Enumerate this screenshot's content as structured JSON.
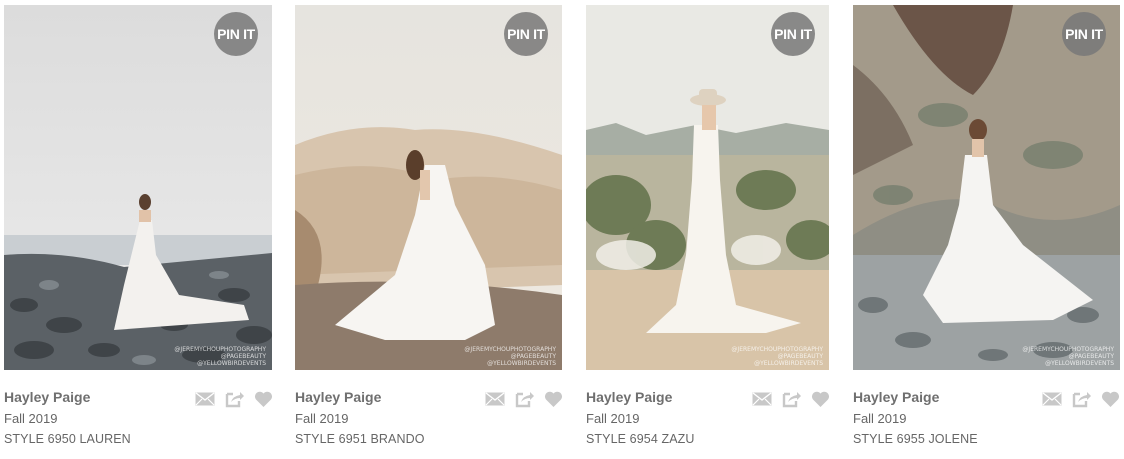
{
  "cards": [
    {
      "pin_label": "PIN IT",
      "designer": "Hayley Paige",
      "season": "Fall 2019",
      "style": "STYLE 6950 LAUREN",
      "credit": [
        "@JEREMYCHOUPHOTOGRAPHY",
        "@PAGEBEAUTY",
        "@YELLOWBIRDEVENTS"
      ]
    },
    {
      "pin_label": "PIN IT",
      "designer": "Hayley Paige",
      "season": "Fall 2019",
      "style": "STYLE 6951 BRANDO",
      "credit": [
        "@JEREMYCHOUPHOTOGRAPHY",
        "@PAGEBEAUTY",
        "@YELLOWBIRDEVENTS"
      ]
    },
    {
      "pin_label": "PIN IT",
      "designer": "Hayley Paige",
      "season": "Fall 2019",
      "style": "STYLE 6954 ZAZU",
      "credit": [
        "@JEREMYCHOUPHOTOGRAPHY",
        "@PAGEBEAUTY",
        "@YELLOWBIRDEVENTS"
      ]
    },
    {
      "pin_label": "PIN IT",
      "designer": "Hayley Paige",
      "season": "Fall 2019",
      "style": "STYLE 6955 JOLENE",
      "credit": [
        "@JEREMYCHOUPHOTOGRAPHY",
        "@PAGEBEAUTY",
        "@YELLOWBIRDEVENTS"
      ]
    }
  ],
  "icons": [
    "email-icon",
    "share-icon",
    "heart-icon"
  ],
  "colors": {
    "icon": "#c8c8c8",
    "text": "#666666",
    "pin_bg": "#787878"
  }
}
